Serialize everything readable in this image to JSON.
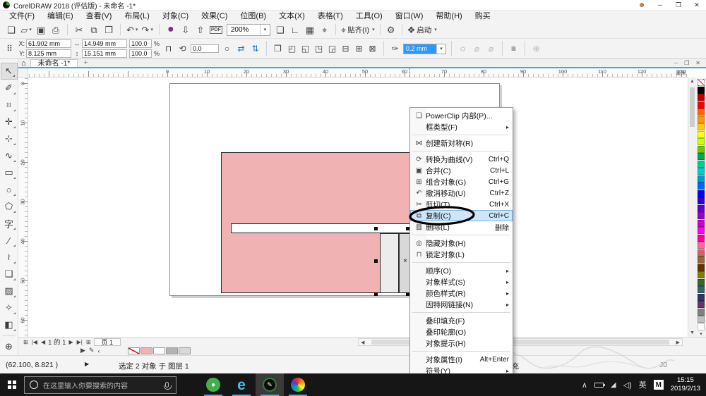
{
  "window": {
    "title": "CorelDRAW 2018 (评估版) - 未命名 -1*",
    "minimize": "─",
    "restore": "❐",
    "close": "✕"
  },
  "menubar": {
    "items": [
      "文件(F)",
      "编辑(E)",
      "查看(V)",
      "布局(L)",
      "对象(C)",
      "效果(C)",
      "位图(B)",
      "文本(X)",
      "表格(T)",
      "工具(O)",
      "窗口(W)",
      "帮助(H)",
      "购买"
    ]
  },
  "toolbar": {
    "buttons_left": [
      {
        "name": "new-document-icon",
        "glyph": "❏"
      },
      {
        "name": "open-icon",
        "glyph": "▱",
        "dropdown": true
      },
      {
        "name": "save-icon",
        "glyph": "▣"
      },
      {
        "name": "print-icon",
        "glyph": "⎙"
      },
      {
        "name": "sep"
      },
      {
        "name": "cut-icon",
        "glyph": "✂"
      },
      {
        "name": "copy-icon",
        "glyph": "⧉"
      },
      {
        "name": "paste-icon",
        "glyph": "❐"
      },
      {
        "name": "sep"
      },
      {
        "name": "undo-icon",
        "glyph": "↶",
        "dropdown": true
      },
      {
        "name": "redo-icon",
        "glyph": "↷",
        "dropdown": true
      },
      {
        "name": "sep"
      },
      {
        "name": "search-content-icon",
        "glyph": "●",
        "color": "#7b2f8e"
      },
      {
        "name": "import-icon",
        "glyph": "⇩"
      },
      {
        "name": "export-icon",
        "glyph": "⇧"
      },
      {
        "name": "pdf-icon",
        "glyph": "PDF",
        "text": true
      }
    ],
    "zoom_level": "200%",
    "zoom_caret": "▾",
    "buttons_right": [
      {
        "name": "fullscreen-preview-icon",
        "glyph": "❑"
      },
      {
        "name": "show-rulers-icon",
        "glyph": "∟"
      },
      {
        "name": "show-grid-icon",
        "glyph": "▦"
      },
      {
        "name": "snap-indicator-icon",
        "glyph": "⌖"
      }
    ],
    "snap_label": "贴齐(I)",
    "snap_caret": "▾",
    "options_icon": "⚙",
    "launch_icon": "❖",
    "launch_label": "启动",
    "launch_caret": "▾"
  },
  "propbar": {
    "origin_icon": "⠿",
    "x_label": "X:",
    "x_value": "61.902 mm",
    "y_label": "Y:",
    "y_value": "8.125 mm",
    "width_icon": "↔",
    "width_value": "14.949 mm",
    "height_icon": "↕",
    "height_value": "15.151 mm",
    "scale_x": "100.0",
    "scale_y": "100.0",
    "percent": "%",
    "lock_ratio_icon": "⊓",
    "rotate_icon": "⟲",
    "angle_value": "0.0",
    "angle_dial_icon": "○",
    "mirror_h_icon": "⇄",
    "mirror_v_icon": "⇅",
    "order_icon": "❒",
    "shaping": [
      {
        "name": "weld-icon",
        "glyph": "◰"
      },
      {
        "name": "trim-icon",
        "glyph": "◱"
      },
      {
        "name": "intersect-icon",
        "glyph": "◳"
      },
      {
        "name": "simplify-icon",
        "glyph": "◲"
      },
      {
        "name": "front-minus-back-icon",
        "glyph": "⊟"
      },
      {
        "name": "back-minus-front-icon",
        "glyph": "⊞"
      },
      {
        "name": "create-boundary-icon",
        "glyph": "⊠"
      }
    ],
    "outline_pen_icon": "✑",
    "outline_width": "0.2 mm",
    "outline_caret": "▾",
    "wrap_text_icon": "◌",
    "disabled_icon_1": "⌀",
    "disabled_icon_2": "⌀",
    "align_icon": "≡",
    "quick-customize-icon": "⊕"
  },
  "doctab": {
    "home_icon": "⌂",
    "title": "未命名 -1*",
    "new_tab_icon": "+",
    "minimize": "─",
    "restore": "❐",
    "close": "✕"
  },
  "hruler": {
    "labels": [
      "0",
      "10",
      "20",
      "30",
      "40",
      "50",
      "60",
      "70",
      "80",
      "90",
      "100",
      "110",
      "120",
      "130"
    ],
    "unit": "毫米"
  },
  "vruler": {
    "labels": [
      "0",
      "10",
      "20",
      "30",
      "40",
      "50",
      "60"
    ]
  },
  "toolbox": {
    "items": [
      {
        "name": "pick-tool",
        "glyph": "↖"
      },
      {
        "name": "shape-tool",
        "glyph": "✐"
      },
      {
        "name": "crop-tool",
        "glyph": "⌗"
      },
      {
        "name": "pan-tool",
        "glyph": "✛"
      },
      {
        "name": "freehand-pick-tool",
        "glyph": "⊹"
      },
      {
        "name": "curve-tool",
        "glyph": "∿"
      },
      {
        "name": "rectangle-tool",
        "glyph": "▭"
      },
      {
        "name": "ellipse-tool",
        "glyph": "○"
      },
      {
        "name": "polygon-tool",
        "glyph": "⬠"
      },
      {
        "name": "text-tool",
        "glyph": "字"
      },
      {
        "name": "dimension-tool",
        "glyph": "∕"
      },
      {
        "name": "connector-tool",
        "glyph": "≀"
      },
      {
        "name": "shadow-tool",
        "glyph": "❏"
      },
      {
        "name": "transparency-tool",
        "glyph": "▨"
      },
      {
        "name": "eyedropper-tool",
        "glyph": "✧"
      },
      {
        "name": "interactive-fill-tool",
        "glyph": "◧"
      },
      {
        "name": "more-tools",
        "glyph": "⊕"
      },
      {
        "name": "toolbox-expand",
        "glyph": "»"
      }
    ]
  },
  "context_menu": {
    "items": [
      {
        "icon": "powerclip-icon",
        "glyph": "❏",
        "label": "PowerClip 内部(P)..."
      },
      {
        "label": "框类型(F)",
        "submenu": true
      },
      {
        "type": "sep"
      },
      {
        "icon": "symmetry-icon",
        "glyph": "⋈",
        "label": "创建新对称(R)"
      },
      {
        "type": "sep"
      },
      {
        "icon": "convert-to-curves-icon",
        "glyph": "⟳",
        "label": "转换为曲线(V)",
        "shortcut": "Ctrl+Q"
      },
      {
        "icon": "combine-icon",
        "glyph": "▣",
        "label": "合并(C)",
        "shortcut": "Ctrl+L"
      },
      {
        "icon": "group-objects-icon",
        "glyph": "⊞",
        "label": "组合对象(G)",
        "shortcut": "Ctrl+G"
      },
      {
        "icon": "undo-move-icon",
        "glyph": "↶",
        "label": "撤消移动(U)",
        "shortcut": "Ctrl+Z"
      },
      {
        "icon": "cut-icon",
        "glyph": "✂",
        "label": "剪切(T)",
        "shortcut": "Ctrl+X"
      },
      {
        "icon": "copy-icon",
        "glyph": "⧉",
        "label": "复制(C)",
        "shortcut": "Ctrl+C",
        "highlighted": true
      },
      {
        "icon": "delete-icon",
        "glyph": "▥",
        "label": "删除(L)",
        "shortcut": "删除"
      },
      {
        "type": "sep"
      },
      {
        "icon": "hide-object-icon",
        "glyph": "◎",
        "label": "隐藏对象(H)"
      },
      {
        "icon": "lock-object-icon",
        "glyph": "⊓",
        "label": "锁定对象(L)"
      },
      {
        "type": "sep"
      },
      {
        "label": "顺序(O)",
        "submenu": true
      },
      {
        "label": "对象样式(S)",
        "submenu": true
      },
      {
        "label": "颜色样式(R)",
        "submenu": true
      },
      {
        "label": "因特网链接(N)",
        "submenu": true
      },
      {
        "type": "sep"
      },
      {
        "label": "叠印填充(F)"
      },
      {
        "label": "叠印轮廓(O)"
      },
      {
        "label": "对象提示(H)"
      },
      {
        "type": "sep"
      },
      {
        "label": "对象属性(I)",
        "shortcut": "Alt+Enter"
      },
      {
        "label": "符号(Y)",
        "submenu": true
      }
    ]
  },
  "canvas": {
    "pink_fill": "#f0b2b2",
    "gray_a_fill": "#ececec",
    "gray_b_fill": "#d8d8d8",
    "bar_fill": "#ffffff",
    "center_marker": "×"
  },
  "palette": {
    "colors": [
      "none",
      "#000000",
      "#c00000",
      "#ff0000",
      "#ff6600",
      "#ff9900",
      "#ffcc00",
      "#ffff00",
      "#ccff00",
      "#66cc00",
      "#00a651",
      "#00cc99",
      "#00cccc",
      "#0099cc",
      "#0066ff",
      "#0000ff",
      "#3300cc",
      "#6600cc",
      "#9900cc",
      "#cc00cc",
      "#ff00ff",
      "#ff0099",
      "#ff6699",
      "#cc6666",
      "#996633",
      "#663300",
      "#808000",
      "#336633",
      "#336666",
      "#333366",
      "#663366",
      "#808080",
      "#c0c0c0",
      "#ffffff"
    ],
    "more_icon": "▾"
  },
  "docpalette": {
    "flyout_icon": "▶",
    "pen_icon": "✎",
    "nav_icon": "‹",
    "colors": [
      "none",
      "#f0b2b2",
      "#ffffff",
      "#b3b3b3",
      "#d9d9d9"
    ]
  },
  "pagebar": {
    "add_page_left": "⊞",
    "go_first": "|◀",
    "go_prev": "◀",
    "page_info": "1 的 1",
    "go_next": "▶",
    "go_last": "▶|",
    "add_page_right": "⊞",
    "page_tab": "页 1",
    "hscroll_left": "◀",
    "hscroll_right": "▶"
  },
  "statusbar": {
    "coords": "(62.100, 8.821 )",
    "flyout": "▶",
    "selection": "选定 2 对象 于 图层 1",
    "fill_label": "填充",
    "right_text": "J0"
  },
  "taskbar": {
    "search_placeholder": "在这里输入你要搜索的内容",
    "tray_expand": "∧",
    "wifi_icon": "◢",
    "speaker_icon": "◁)",
    "lang": "英",
    "ime_badge": "M",
    "time": "15:15",
    "date": "2019/2/13"
  }
}
